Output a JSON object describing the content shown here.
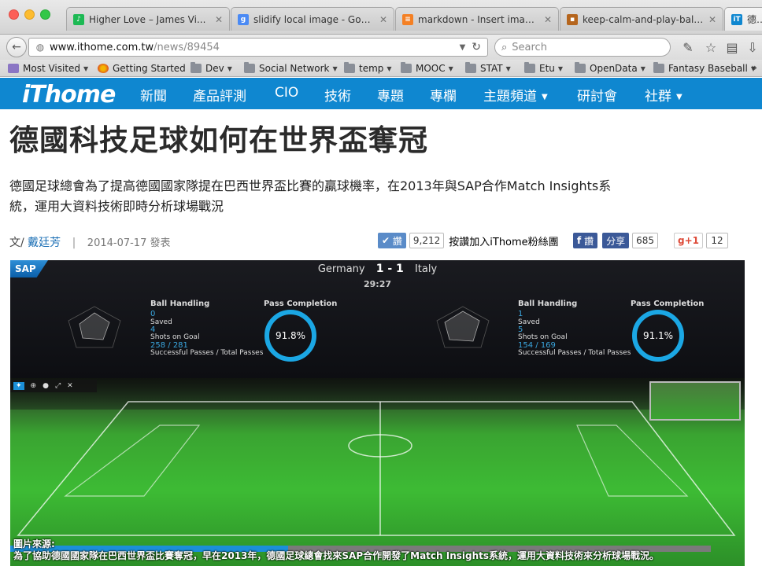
{
  "browser": {
    "tabs": [
      {
        "title": "Higher Love – James Vi...",
        "icon": "spotify-icon",
        "color": "#2a2a2a"
      },
      {
        "title": "slidify local image - Googl...",
        "icon": "google-icon",
        "color": "#4a8af4"
      },
      {
        "title": "markdown - Insert image ...",
        "icon": "stackoverflow-icon",
        "color": "#f48024"
      },
      {
        "title": "keep-calm-and-play-ball...",
        "icon": "image-icon",
        "color": "#b5651d"
      },
      {
        "title": "德國科技足球如何在...",
        "icon": "ithome-icon",
        "color": "#0f87d0"
      }
    ],
    "url_host": "www.ithome.com.tw",
    "url_path": "/news/89454",
    "search_placeholder": "Search",
    "bookmarks": [
      {
        "label": "Most Visited",
        "type": "special",
        "dropdown": true
      },
      {
        "label": "Getting Started",
        "type": "firefox",
        "dropdown": false
      },
      {
        "label": "Dev",
        "type": "folder",
        "dropdown": true
      },
      {
        "label": "Social Network",
        "type": "folder",
        "dropdown": true
      },
      {
        "label": "temp",
        "type": "folder",
        "dropdown": true
      },
      {
        "label": "MOOC",
        "type": "folder",
        "dropdown": true
      },
      {
        "label": "STAT",
        "type": "folder",
        "dropdown": true
      },
      {
        "label": "Etu",
        "type": "folder",
        "dropdown": true
      },
      {
        "label": "OpenData",
        "type": "folder",
        "dropdown": true
      },
      {
        "label": "Fantasy Baseball",
        "type": "folder",
        "dropdown": true
      }
    ]
  },
  "site": {
    "logo": "iThome",
    "brand_color": "#0f87d0",
    "nav": [
      {
        "label": "新聞",
        "dropdown": false
      },
      {
        "label": "產品評測",
        "dropdown": false
      },
      {
        "label": "CIO",
        "dropdown": false
      },
      {
        "label": "技術",
        "dropdown": false
      },
      {
        "label": "專題",
        "dropdown": false
      },
      {
        "label": "專欄",
        "dropdown": false
      },
      {
        "label": "主題頻道",
        "dropdown": true
      },
      {
        "label": "研討會",
        "dropdown": false
      },
      {
        "label": "社群",
        "dropdown": true
      }
    ]
  },
  "article": {
    "headline": "德國科技足球如何在世界盃奪冠",
    "summary_line1": "德國足球總會為了提高德國國家隊提在巴西世界盃比賽的贏球機率，在2013年與SAP合作Match Insights系",
    "summary_line2": "統，運用大資料技術即時分析球場戰況",
    "byline_prefix": "文/",
    "author": "戴廷芳",
    "date": "2014-07-17 發表",
    "social": {
      "like_label": "讚",
      "like_count": "9,212",
      "fan_text": "按讚加入iThome粉絲團",
      "fb_like_label": "讚",
      "fb_share_label": "分享",
      "fb_share_count": "685",
      "gplus_label": "g+1",
      "gplus_count": "12"
    },
    "hero": {
      "score_left": "Germany",
      "score": "1 - 1",
      "score_right": "Italy",
      "clock": "29:27",
      "sap_logo": "SAP",
      "left_panel": {
        "ball_handling": "Ball Handling",
        "saved_val": "0",
        "saved_label": "Saved",
        "shots_val": "4",
        "shots_label": "Shots on Goal",
        "passes_val": "258 / 281",
        "passes_label": "Successful Passes / Total Passes",
        "completion_label": "Pass Completion",
        "completion_val": "91.8%"
      },
      "right_panel": {
        "ball_handling": "Ball Handling",
        "saved_val": "1",
        "saved_label": "Saved",
        "shots_val": "5",
        "shots_label": "Shots on Goal",
        "passes_val": "154 / 169",
        "passes_label": "Successful Passes / Total Passes",
        "completion_label": "Pass Completion",
        "completion_val": "91.1%"
      },
      "caption_line1": "圖片來源:",
      "caption_line2": "為了協助德國國家隊在巴西世界盃比賽奪冠，早在2013年，德國足球總會找來SAP合作開發了Match Insights系統，運用大資料技術來分析球場戰況。"
    }
  }
}
